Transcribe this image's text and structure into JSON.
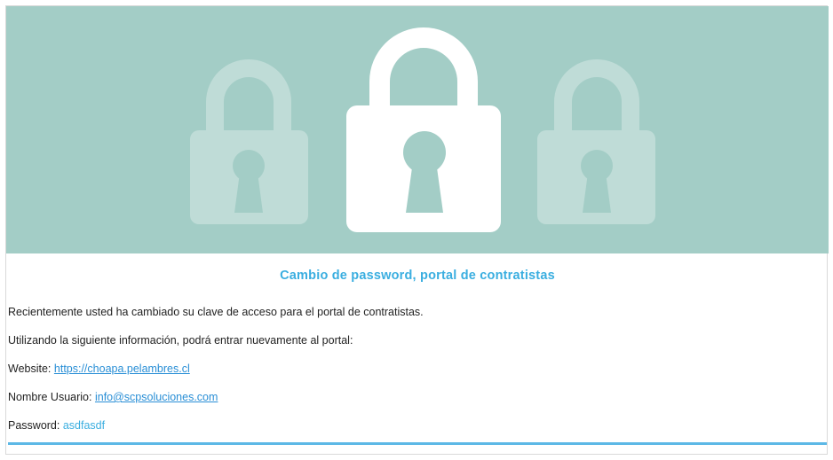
{
  "banner": {
    "background": "#a3cdc6",
    "icons": [
      "padlock-icon",
      "padlock-icon",
      "padlock-icon"
    ]
  },
  "email": {
    "title": "Cambio de password, portal de contratistas",
    "intro": "Recientemente usted ha cambiado su clave de acceso para el portal de contratistas.",
    "instruction": "Utilizando la siguiente información, podrá entrar nuevamente al portal:",
    "website_label": "Website:",
    "website_value": "https://choapa.pelambres.cl",
    "username_label": "Nombre Usuario:",
    "username_value": "info@scpsoluciones.com",
    "password_label": "Password:",
    "password_value": "asdfasdf"
  },
  "colors": {
    "accent": "#3aaee0",
    "link": "#2a8fd6",
    "rule": "#5cb8e6"
  }
}
